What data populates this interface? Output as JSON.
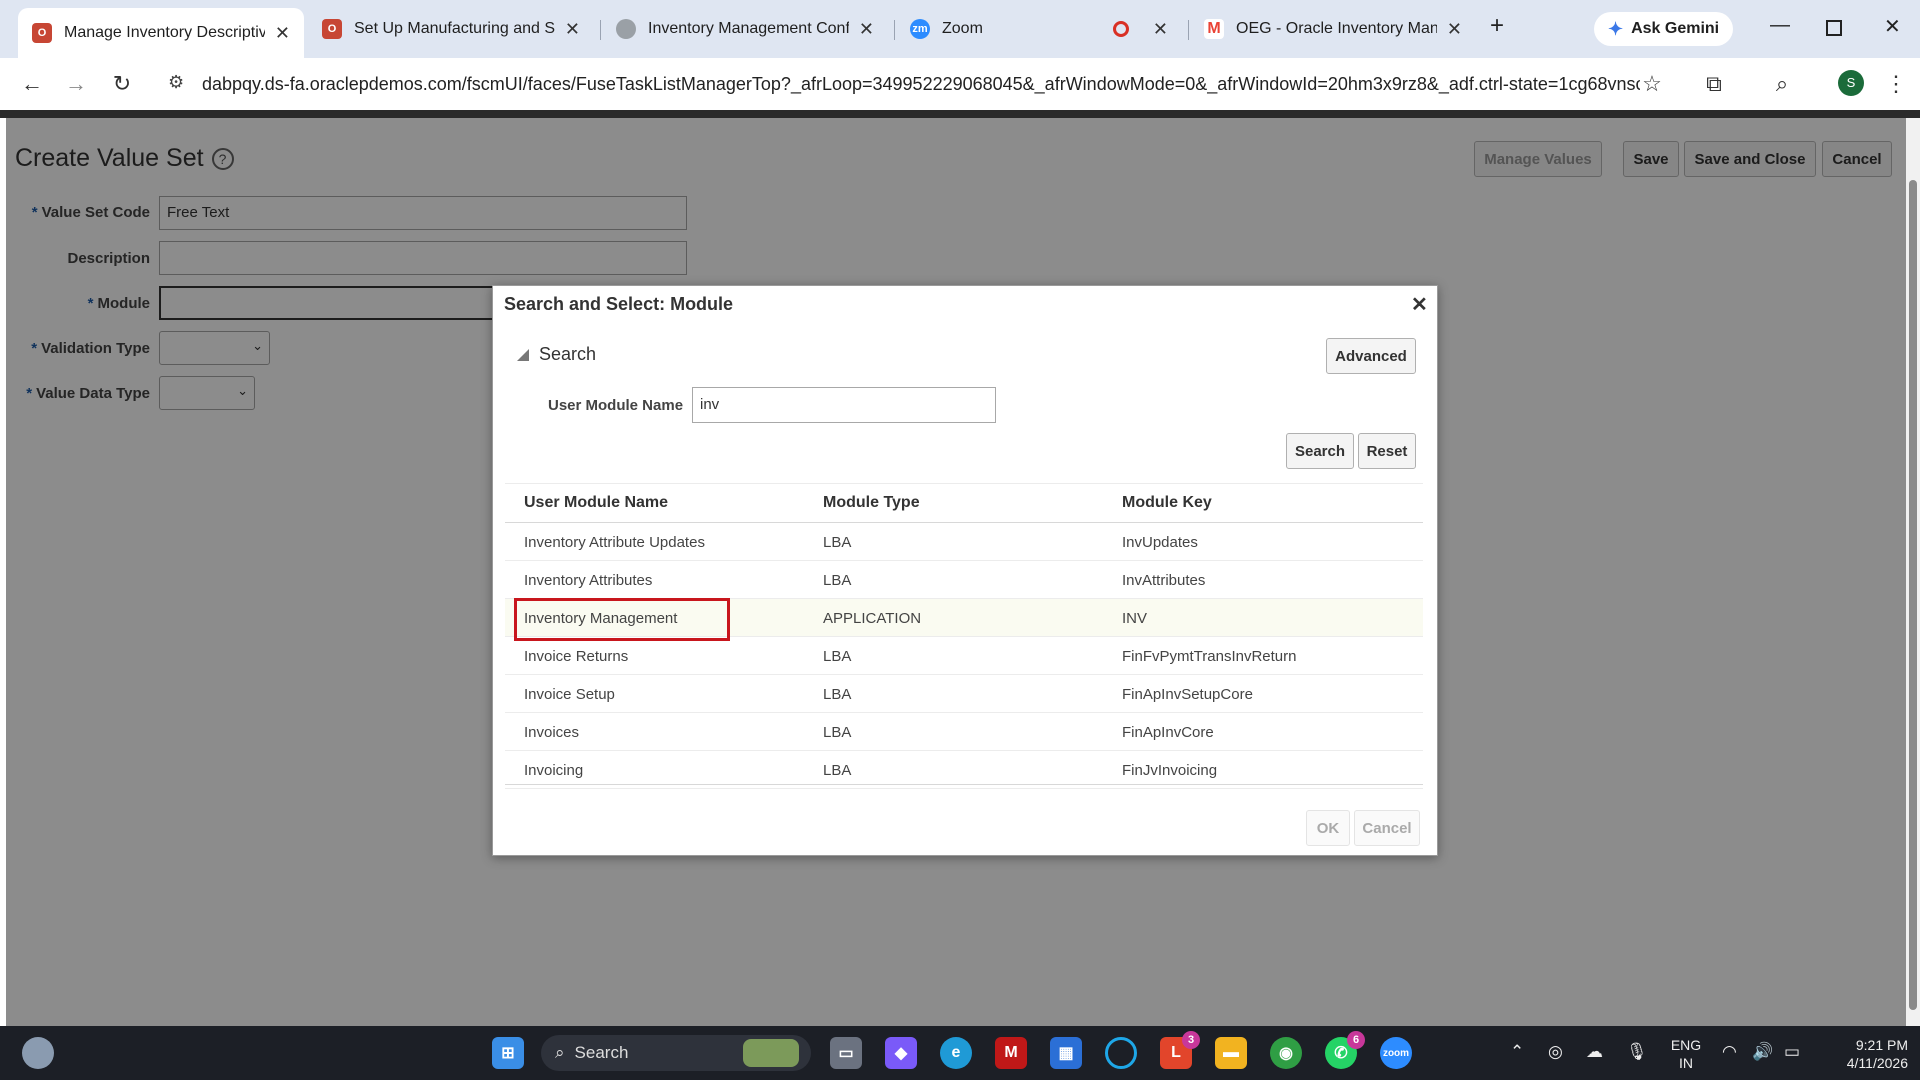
{
  "browser": {
    "tabs": [
      {
        "title": "Manage Inventory Descriptive",
        "favicon": "oracle-icon",
        "color": "#c74634",
        "active": true
      },
      {
        "title": "Set Up Manufacturing and Sup",
        "favicon": "oracle-icon",
        "color": "#c74634",
        "active": false
      },
      {
        "title": "Inventory Management Config",
        "favicon": "globe-icon",
        "color": "#9aa0a6",
        "active": false
      },
      {
        "title": "Zoom",
        "favicon": "zoom-icon",
        "color": "#2d8cff",
        "active": false
      },
      {
        "title": "OEG - Oracle Inventory Manag",
        "favicon": "gmail-icon",
        "color": "#ea4335",
        "active": false
      }
    ],
    "gemini_label": "Ask Gemini",
    "url": "dabpqy.ds-fa.oraclepdemos.com/fscmUI/faces/FuseTaskListManagerTop?_afrLoop=349952229068045&_afrWindowMode=0&_afrWindowId=20hm3x9rz8&_adf.ctrl-state=1cg68vnsch_...",
    "profile_initial": "S"
  },
  "page": {
    "title": "Create Value Set",
    "buttons": {
      "manage_values": "Manage Values",
      "save": "Save",
      "save_and_close": "Save and Close",
      "cancel": "Cancel"
    },
    "fields": {
      "value_set_code": {
        "label": "Value Set Code",
        "value": "Free Text",
        "required": true
      },
      "description": {
        "label": "Description",
        "value": "",
        "required": false
      },
      "module": {
        "label": "Module",
        "value": "",
        "required": true
      },
      "validation_type": {
        "label": "Validation Type",
        "value": "",
        "required": true
      },
      "value_data_type": {
        "label": "Value Data Type",
        "value": "",
        "required": true
      }
    }
  },
  "dialog": {
    "title": "Search and Select: Module",
    "search_header": "Search",
    "advanced_label": "Advanced",
    "search_field": {
      "label": "User Module Name",
      "value": "inv"
    },
    "search_button": "Search",
    "reset_button": "Reset",
    "columns": [
      "User Module Name",
      "Module Type",
      "Module Key"
    ],
    "rows": [
      {
        "name": "Inventory Attribute Updates",
        "type": "LBA",
        "key": "InvUpdates"
      },
      {
        "name": "Inventory Attributes",
        "type": "LBA",
        "key": "InvAttributes"
      },
      {
        "name": "Inventory Management",
        "type": "APPLICATION",
        "key": "INV"
      },
      {
        "name": "Invoice Returns",
        "type": "LBA",
        "key": "FinFvPymtTransInvReturn"
      },
      {
        "name": "Invoice Setup",
        "type": "LBA",
        "key": "FinApInvSetupCore"
      },
      {
        "name": "Invoices",
        "type": "LBA",
        "key": "FinApInvCore"
      },
      {
        "name": "Invoicing",
        "type": "LBA",
        "key": "FinJvInvoicing"
      }
    ],
    "selected_row": "Inventory Management",
    "ok_button": "OK",
    "cancel_button": "Cancel"
  },
  "taskbar": {
    "search_placeholder": "Search",
    "badges": {
      "l_app": "3",
      "whatsapp": "6"
    },
    "language": "ENG",
    "region": "IN",
    "time": "9:21 PM",
    "date": "4/11/2026"
  }
}
